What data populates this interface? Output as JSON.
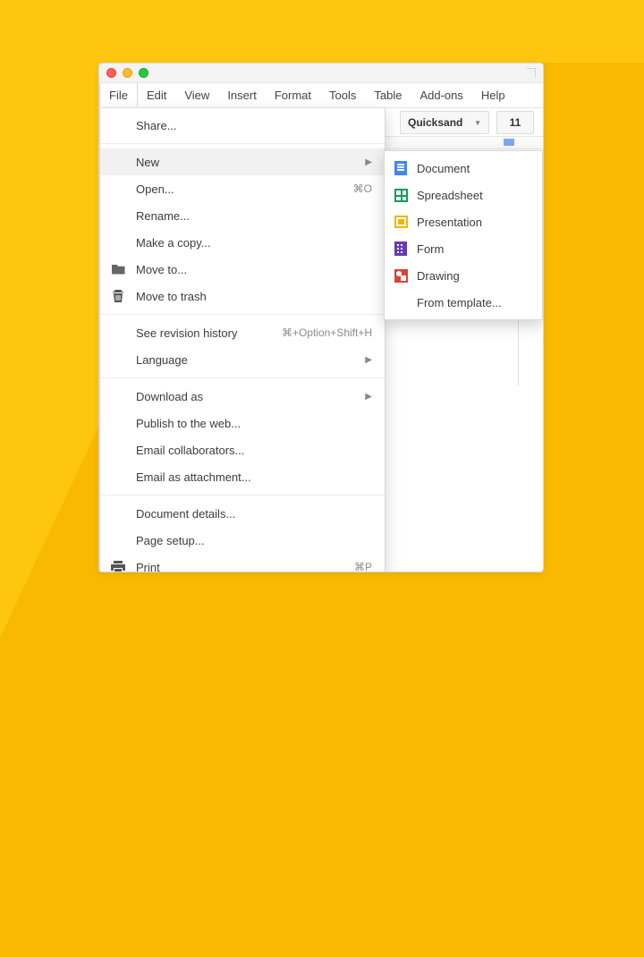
{
  "menubar": {
    "items": [
      "File",
      "Edit",
      "View",
      "Insert",
      "Format",
      "Tools",
      "Table",
      "Add-ons",
      "Help"
    ],
    "active_index": 0
  },
  "toolbar": {
    "font_name": "Quicksand",
    "font_size": "11"
  },
  "file_menu": {
    "share": "Share...",
    "new": "New",
    "open": {
      "label": "Open...",
      "shortcut": "⌘O"
    },
    "rename": "Rename...",
    "make_copy": "Make a copy...",
    "move_to": "Move to...",
    "move_to_trash": "Move to trash",
    "revision": {
      "label": "See revision history",
      "shortcut": "⌘+Option+Shift+H"
    },
    "language": "Language",
    "download_as": "Download as",
    "publish_web": "Publish to the web...",
    "email_collab": "Email collaborators...",
    "email_attach": "Email as attachment...",
    "doc_details": "Document details...",
    "page_setup": "Page setup...",
    "print": {
      "label": "Print",
      "shortcut": "⌘P"
    }
  },
  "new_submenu": {
    "document": "Document",
    "spreadsheet": "Spreadsheet",
    "presentation": "Presentation",
    "form": "Form",
    "drawing": "Drawing",
    "from_template": "From template..."
  }
}
